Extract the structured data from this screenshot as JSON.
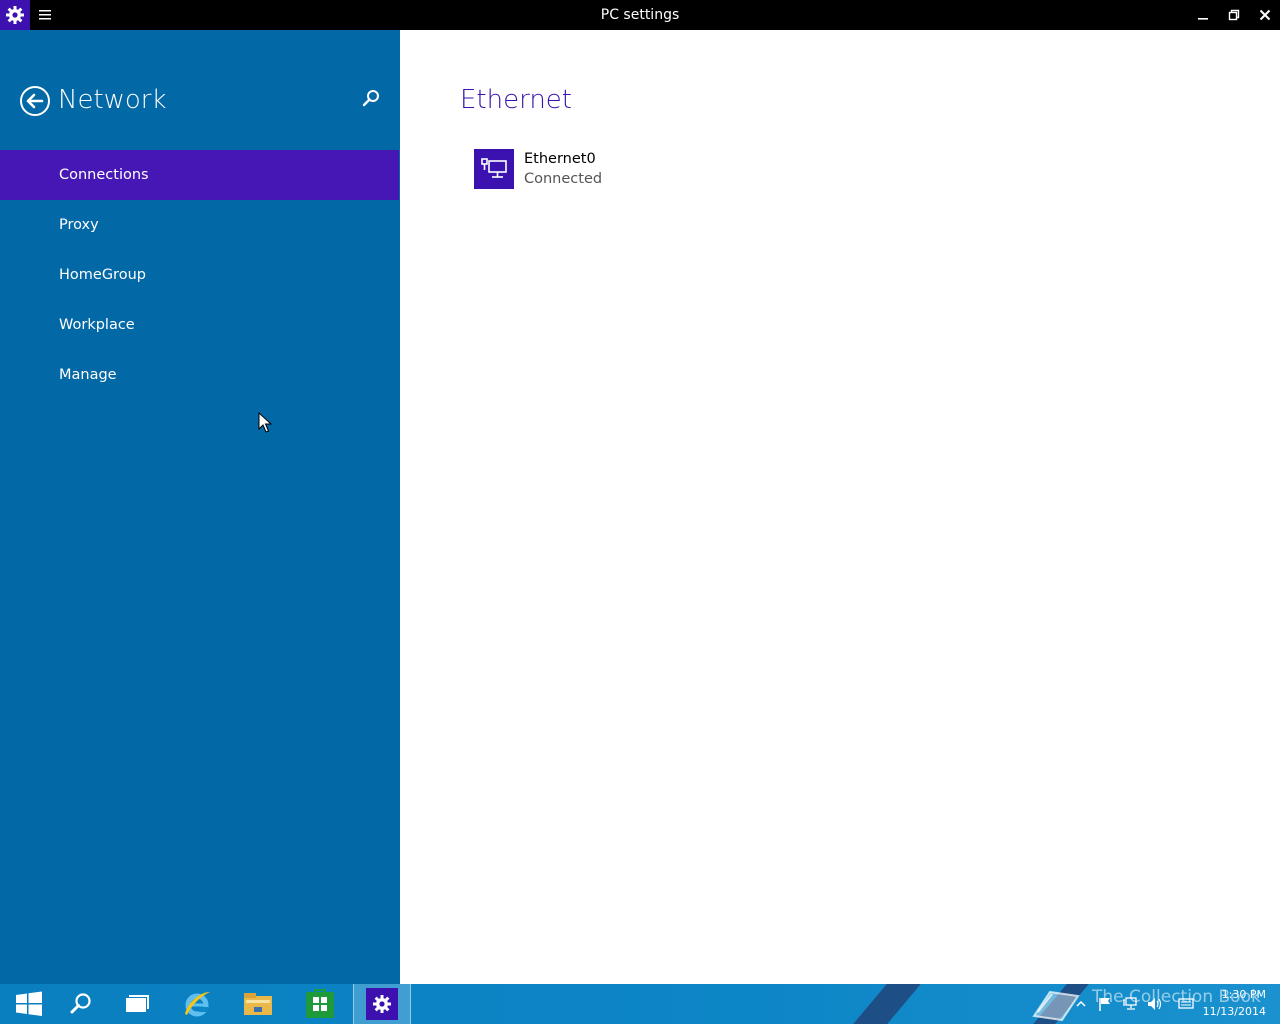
{
  "window": {
    "title": "PC settings",
    "app_icon": "gear-icon",
    "menu_icon": "hamburger-menu-icon",
    "controls": [
      "minimize-icon",
      "restore-icon",
      "close-icon"
    ]
  },
  "left_pane": {
    "title": "Network",
    "back_icon": "back-arrow-icon",
    "search_icon": "search-icon",
    "nav_items": [
      {
        "label": "Connections",
        "selected": true
      },
      {
        "label": "Proxy",
        "selected": false
      },
      {
        "label": "HomeGroup",
        "selected": false
      },
      {
        "label": "Workplace",
        "selected": false
      },
      {
        "label": "Manage",
        "selected": false
      }
    ]
  },
  "right_pane": {
    "section_title": "Ethernet",
    "connection": {
      "icon": "ethernet-icon",
      "name": "Ethernet0",
      "status": "Connected"
    }
  },
  "taskbar": {
    "items": [
      "start-icon",
      "search-icon",
      "task-view-icon",
      "internet-explorer-icon",
      "file-explorer-icon",
      "store-icon",
      "settings-icon"
    ],
    "active_item": "settings-icon",
    "watermark": "The Collection Book",
    "tray": [
      "show-hidden-icons",
      "flag-icon",
      "network-icon",
      "volume-icon",
      "keyboard-icon"
    ],
    "clock": {
      "time": "1:30 PM",
      "date": "11/13/2014"
    }
  },
  "colors": {
    "left_pane_bg": "#0268a6",
    "selected_item_bg": "#4617b4",
    "accent": "#3b12b0",
    "title_bar": "#000000"
  }
}
